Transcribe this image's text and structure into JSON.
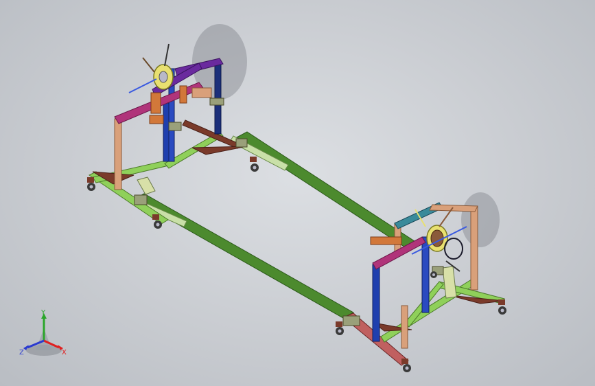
{
  "viewport": {
    "background_top": "#dcdfe3",
    "background_bottom": "#b9bdc3"
  },
  "model": {
    "colors": {
      "frame_green": "#4c8a2e",
      "frame_light_green": "#8fd05a",
      "post_blue": "#1f3fae",
      "post_navy": "#1b2f7a",
      "beam_magenta": "#b0347a",
      "beam_purple": "#6a2a9e",
      "brace_brown": "#7a3a2a",
      "post_tan": "#d9a07a",
      "bracket_teal": "#3a8a9a",
      "bracket_orange": "#d2783a",
      "spool_yellow": "#e8e070",
      "wheel_dark": "#3a3a3a",
      "hub_silver": "#b8b8c8"
    }
  },
  "triad": {
    "x_label": "X",
    "y_label": "Y",
    "z_label": "Z",
    "x_color": "#e02020",
    "y_color": "#2aa62a",
    "z_color": "#2a3ad0"
  }
}
